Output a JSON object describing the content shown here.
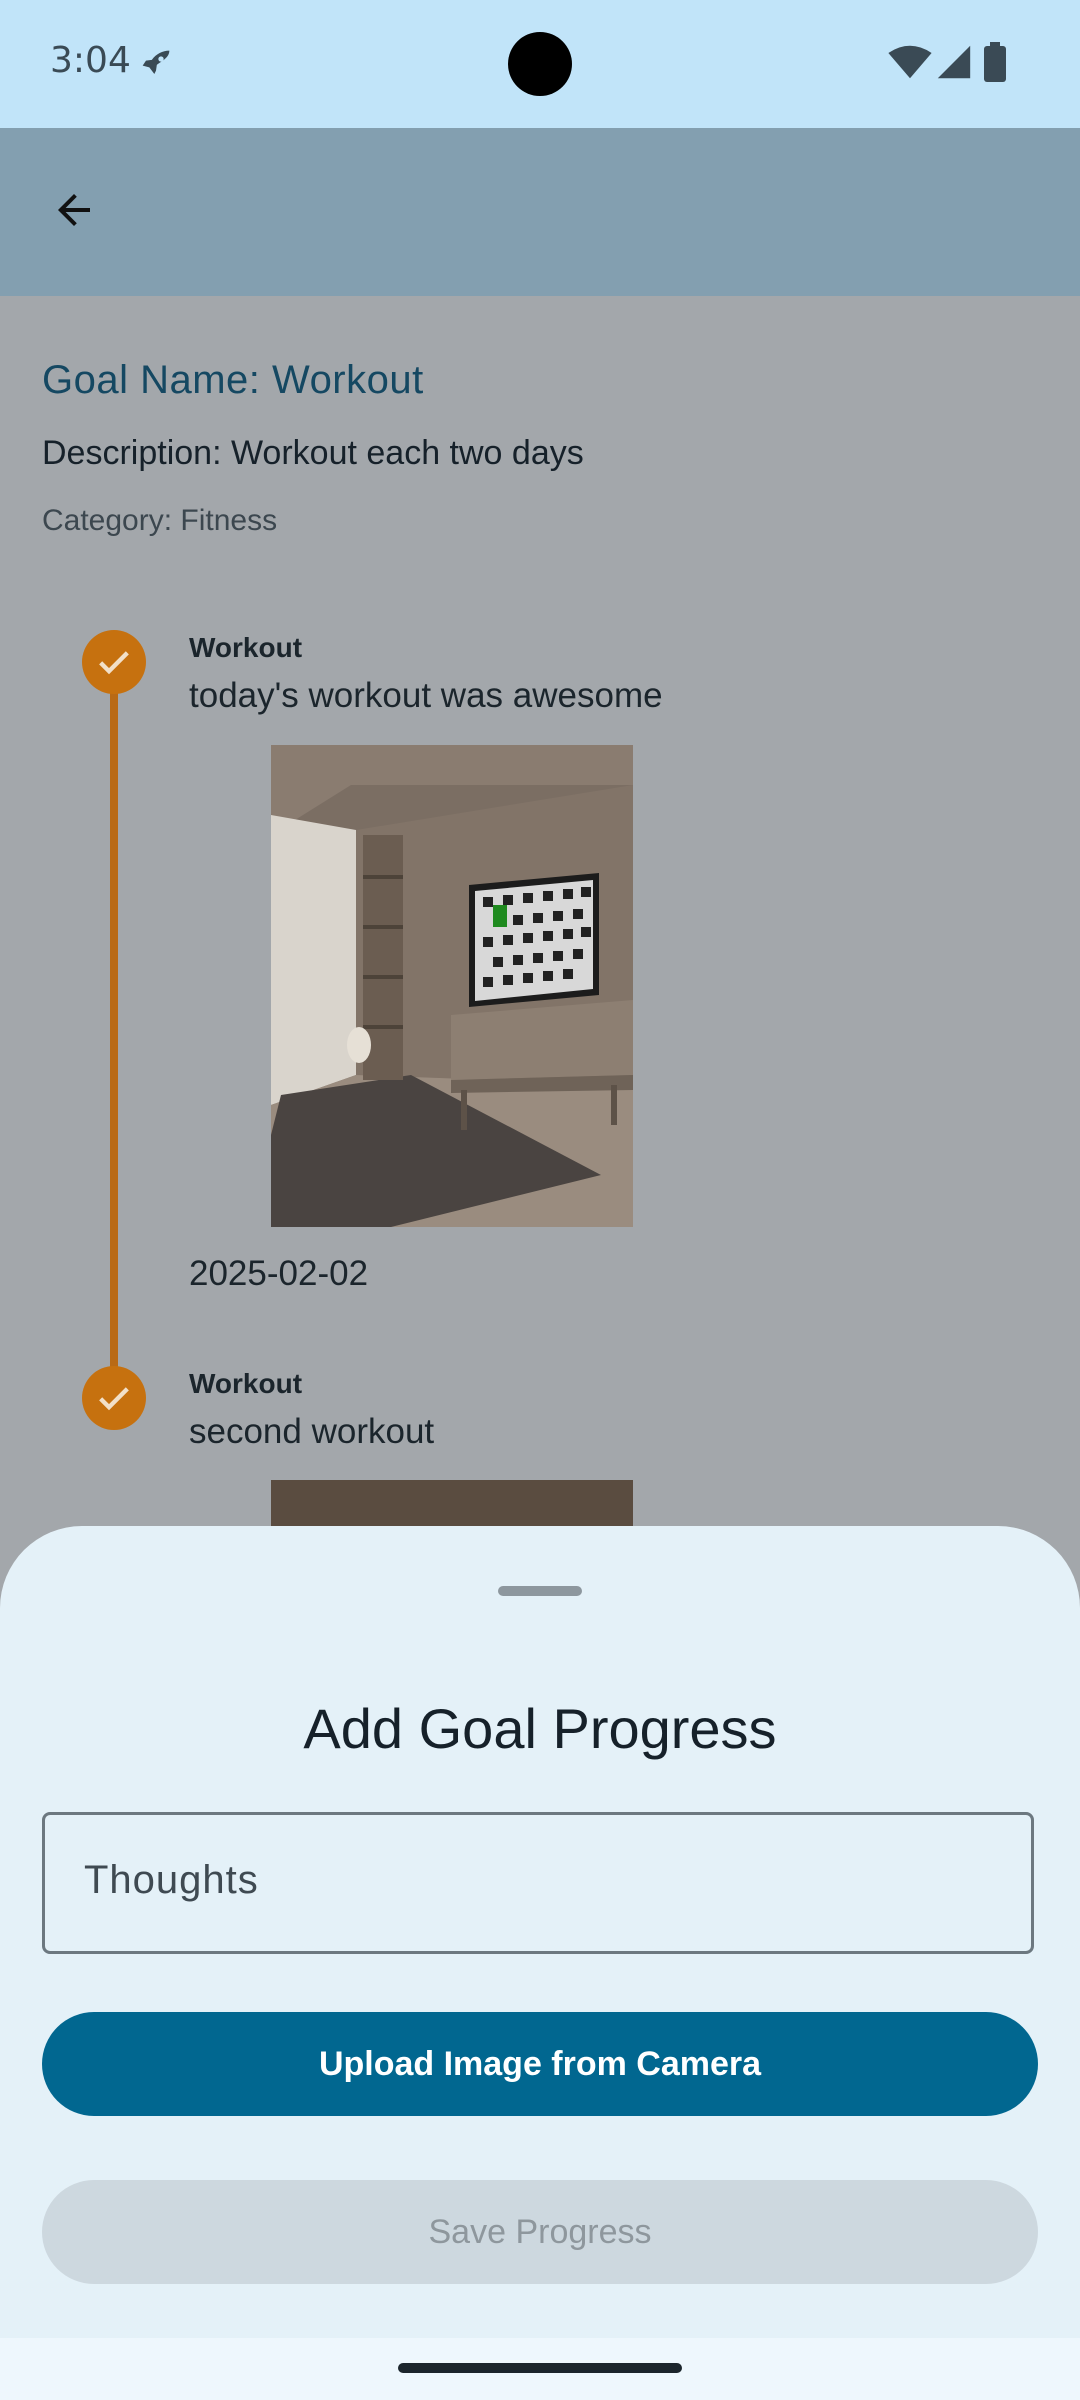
{
  "status_bar": {
    "time": "3:04"
  },
  "app_bar": {
    "back_icon": "arrow-back-icon"
  },
  "goal": {
    "title": "Goal Name: Workout",
    "description": "Description: Workout each two days",
    "category": "Category: Fitness"
  },
  "timeline": {
    "entries": [
      {
        "title": "Workout",
        "text": "today's workout was awesome",
        "date": "2025-02-02",
        "image": "room-photo"
      },
      {
        "title": "Workout",
        "text": "second workout",
        "image": "room-photo"
      }
    ]
  },
  "sheet": {
    "title": "Add Goal Progress",
    "thoughts_placeholder": "Thoughts",
    "upload_label": "Upload Image from Camera",
    "save_label": "Save Progress"
  },
  "colors": {
    "status_bar": "#c1e4f9",
    "app_bar": "#839fb0",
    "accent_orange": "#c6710f",
    "primary_button": "#016790",
    "sheet_bg": "#e4f1f8"
  }
}
